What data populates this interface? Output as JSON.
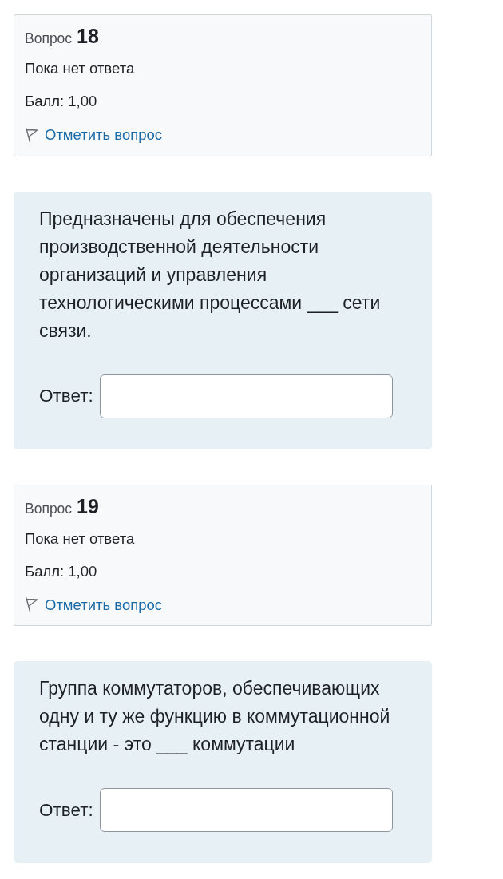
{
  "questions": [
    {
      "info": {
        "label": "Вопрос",
        "number": "18",
        "status": "Пока нет ответа",
        "grade": "Балл: 1,00",
        "flag": {
          "label": "Отметить вопрос",
          "flagged": false
        }
      },
      "text": "Предназначены для обеспечения производственной деятельности организаций и управления технологическими процессами ___ сети связи.",
      "answer": {
        "label": "Ответ:"
      }
    },
    {
      "info": {
        "label": "Вопрос",
        "number": "19",
        "status": "Пока нет ответа",
        "grade": "Балл: 1,00",
        "flag": {
          "label": "Отметить вопрос",
          "flagged": false
        }
      },
      "text": "Группа коммутаторов, обеспечивающих одну и ту же функцию в коммутационной станции - это ___ коммутации",
      "answer": {
        "label": "Ответ:"
      }
    }
  ]
}
